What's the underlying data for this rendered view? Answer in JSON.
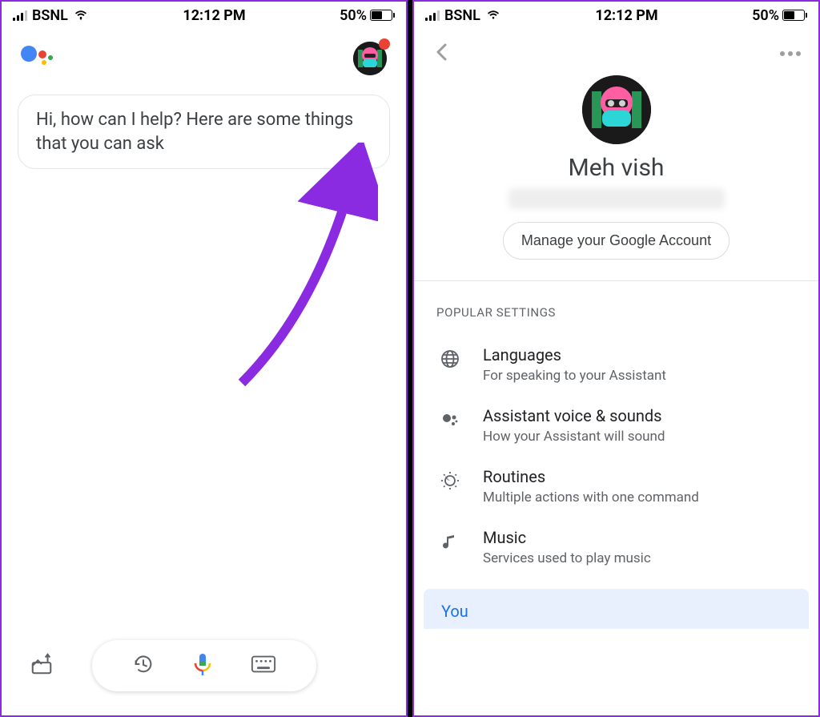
{
  "status": {
    "carrier": "BSNL",
    "time": "12:12 PM",
    "battery": "50%"
  },
  "left": {
    "greeting": "Hi, how can I help? Here are some things that you can ask"
  },
  "right": {
    "profile": {
      "name": "Meh vish",
      "manage_button": "Manage your Google Account"
    },
    "section_label": "POPULAR SETTINGS",
    "settings": [
      {
        "icon": "globe-icon",
        "title": "Languages",
        "sub": "For speaking to your Assistant"
      },
      {
        "icon": "assistant-dots-icon",
        "title": "Assistant voice & sounds",
        "sub": "How your Assistant will sound"
      },
      {
        "icon": "routines-icon",
        "title": "Routines",
        "sub": "Multiple actions with one command"
      },
      {
        "icon": "music-note-icon",
        "title": "Music",
        "sub": "Services used to play music"
      }
    ],
    "bottom_tab": "You"
  }
}
